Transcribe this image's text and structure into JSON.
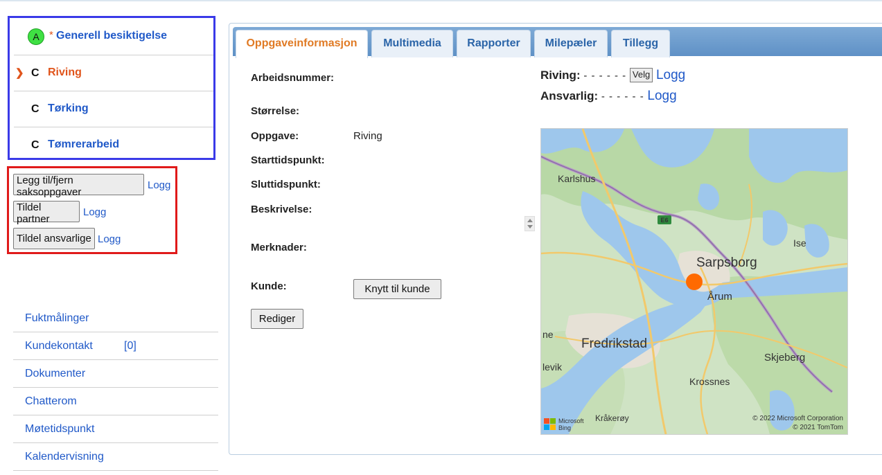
{
  "tasks": [
    {
      "badge": "A",
      "star": "*",
      "code": "",
      "name": "Generell besiktigelse"
    },
    {
      "arrow": "❯",
      "code": "C",
      "name": "Riving"
    },
    {
      "code": "C",
      "name": "Tørking"
    },
    {
      "code": "C",
      "name": "Tømrerarbeid"
    }
  ],
  "actions": {
    "add_remove_label": "Legg til/fjern saksoppgaver",
    "assign_partner_label": "Tildel partner",
    "assign_responsible_label": "Tildel ansvarlige",
    "log_label": "Logg"
  },
  "side_links": [
    {
      "label": "Fuktmålinger"
    },
    {
      "label": "Kundekontakt",
      "count": "[0]"
    },
    {
      "label": "Dokumenter"
    },
    {
      "label": "Chatterom"
    },
    {
      "label": "Møtetidspunkt"
    },
    {
      "label": "Kalendervisning"
    }
  ],
  "tabs": [
    "Oppgaveinformasjon",
    "Multimedia",
    "Rapporter",
    "Milepæler",
    "Tillegg"
  ],
  "form": {
    "arbeidsnummer": "Arbeidsnummer:",
    "storrelse": "Størrelse:",
    "oppgave": "Oppgave:",
    "oppgave_value": "Riving",
    "start": "Starttidspunkt:",
    "slutt": "Sluttidspunkt:",
    "beskrivelse": "Beskrivelse:",
    "merknader": "Merknader:",
    "kunde": "Kunde:",
    "connect_customer": "Knytt til kunde",
    "edit": "Rediger"
  },
  "status": {
    "riving_label": "Riving:",
    "ansvarlig_label": "Ansvarlig:",
    "dashes": "- - - - - -",
    "velg": "Velg",
    "logg": "Logg"
  },
  "map": {
    "places": [
      "Karlshus",
      "Sarpsborg",
      "Ise",
      "Årum",
      "Fredrikstad",
      "Skjeberg",
      "Krossnes",
      "Kråkerøy",
      "levik",
      "ne"
    ],
    "road_label": "E6",
    "brand": "Microsoft\nBing",
    "brand_line1": "Microsoft",
    "brand_line2": "Bing",
    "copyright1": "© 2022 Microsoft Corporation",
    "copyright2": "© 2021 TomTom",
    "marker_color": "#ff6a00"
  }
}
